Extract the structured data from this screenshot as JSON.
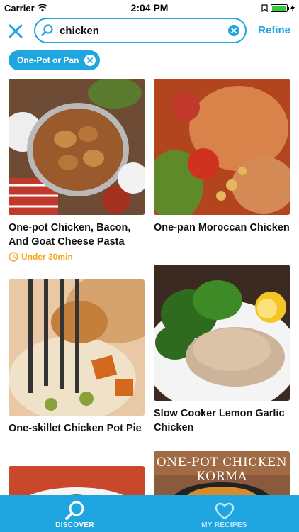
{
  "status": {
    "carrier": "Carrier",
    "time": "2:04 PM"
  },
  "search": {
    "query": "chicken",
    "refine_label": "Refine"
  },
  "filter_chip": {
    "label": "One-Pot or Pan"
  },
  "recipes": [
    {
      "title": "One-pot Chicken, Bacon, And Goat Cheese Pasta",
      "meta": "Under 30min"
    },
    {
      "title": "One-pan Moroccan Chicken"
    },
    {
      "title": "One-skillet Chicken Pot Pie"
    },
    {
      "title": "Slow Cooker Lemon Garlic Chicken"
    },
    {
      "title": ""
    },
    {
      "title": "",
      "image_text": "ONE-POT CHICKEN KORMA"
    }
  ],
  "tabs": [
    {
      "label": "DISCOVER",
      "icon": "search-icon",
      "active": true
    },
    {
      "label": "MY RECIPES",
      "icon": "heart-icon",
      "active": false
    }
  ],
  "colors": {
    "accent": "#1fa6e0",
    "time_meta": "#f5a623"
  }
}
